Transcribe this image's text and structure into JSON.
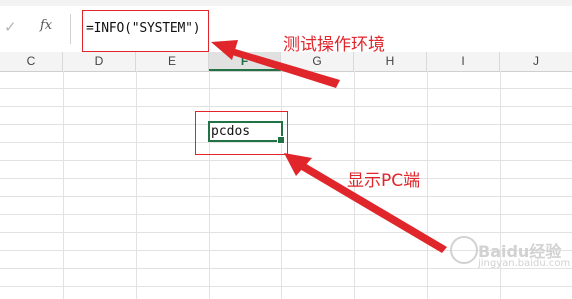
{
  "formula_bar": {
    "confirm_icon": "checkmark-icon",
    "fx_label": "fx",
    "formula": "=INFO(\"SYSTEM\")"
  },
  "columns": [
    "C",
    "D",
    "E",
    "F",
    "G",
    "H",
    "I",
    "J"
  ],
  "selected_column": "F",
  "active_cell": {
    "value": "pcdos"
  },
  "annotations": {
    "formula_note": "测试操作环境",
    "result_note": "显示PC端"
  },
  "colors": {
    "annotation_red": "#e0262b",
    "selection_green": "#217346"
  },
  "watermark": {
    "brand": "Baidu经验",
    "url": "jingyan.baidu.com"
  }
}
